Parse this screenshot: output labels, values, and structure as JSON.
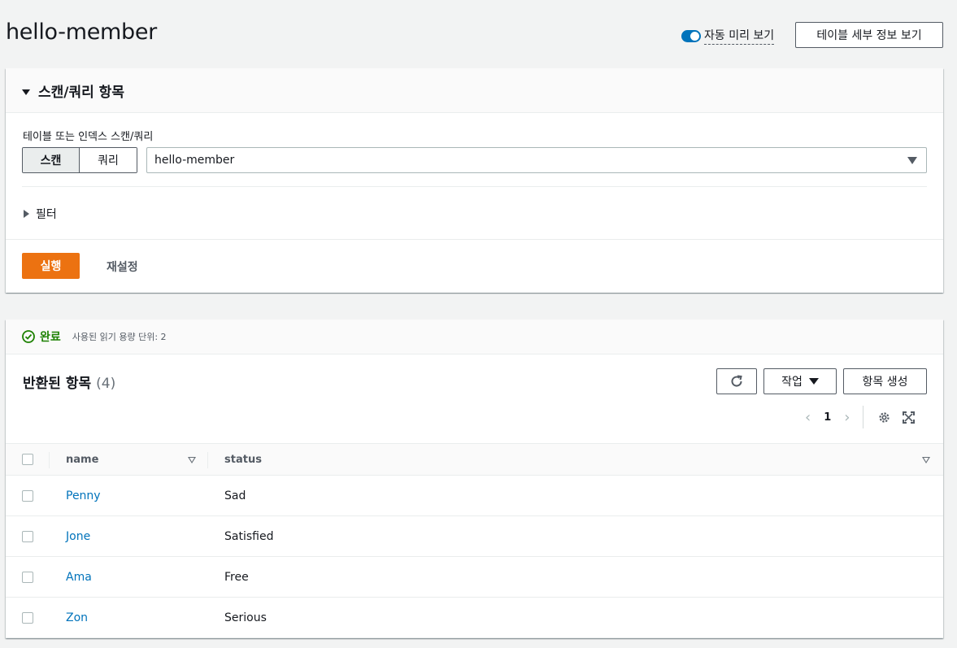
{
  "header": {
    "title": "hello-member",
    "auto_preview_label": "자동 미리 보기",
    "table_details_button": "테이블 세부 정보 보기"
  },
  "scan_panel": {
    "title": "스캔/쿼리 항목",
    "field_label": "테이블 또는 인덱스 스캔/쿼리",
    "segments": [
      "스캔",
      "쿼리"
    ],
    "selected_segment": "스캔",
    "select_value": "hello-member",
    "filter_label": "필터",
    "run_button": "실행",
    "reset_button": "재설정"
  },
  "results": {
    "status": "완료",
    "status_detail": "사용된 읽기 용량 단위: 2",
    "title": "반환된 항목",
    "count": "(4)",
    "action_button": "작업",
    "create_button": "항목 생성",
    "page": "1",
    "columns": [
      "name",
      "status"
    ],
    "rows": [
      {
        "name": "Penny",
        "status": "Sad"
      },
      {
        "name": "Jone",
        "status": "Satisfied"
      },
      {
        "name": "Ama",
        "status": "Free"
      },
      {
        "name": "Zon",
        "status": "Serious"
      }
    ]
  },
  "colors": {
    "accent": "#0073bb",
    "primary_button": "#ec7211",
    "success": "#1d8102"
  }
}
